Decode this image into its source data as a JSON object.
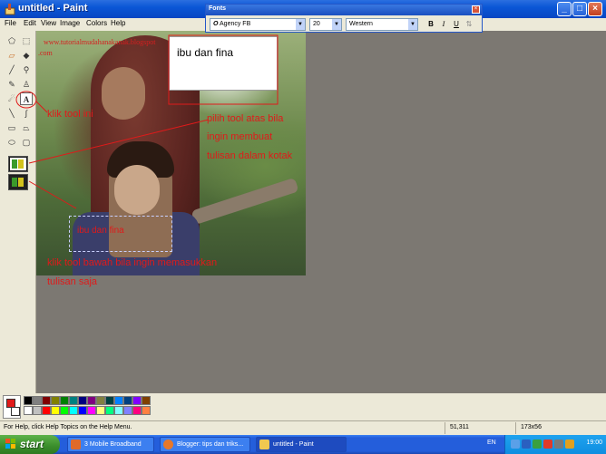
{
  "window": {
    "title": "untitled - Paint",
    "controls": {
      "minimize": "_",
      "maximize": "□",
      "close": "×"
    }
  },
  "menu": [
    "File",
    "Edit",
    "View",
    "Image",
    "Colors",
    "Help"
  ],
  "fonts_toolbar": {
    "title": "Fonts",
    "font_name": "Agency FB",
    "font_size": "20",
    "script": "Western",
    "buttons": [
      "B",
      "I",
      "U",
      "⇅"
    ]
  },
  "canvas": {
    "url_text_line1": "www.tutorialmudahanakanak.blogspot",
    "url_text_line2": ".com",
    "textbox_text": "ibu dan fina",
    "annotation_click": "klik tool ini",
    "annotation_box_1": "pilih tool atas bila",
    "annotation_box_2": "ingin membuat",
    "annotation_box_3": "tulisan dalam kotak",
    "dashed_text": "ibu dan fina",
    "annotation_bottom_1": "klik tool bawah bila ingin memasukkan",
    "annotation_bottom_2": "tulisan saja"
  },
  "palette": {
    "foreground": "#e01a1a",
    "background": "#ffffff",
    "colors_top": [
      "#000000",
      "#808080",
      "#800000",
      "#808000",
      "#008000",
      "#008080",
      "#000080",
      "#800080",
      "#808040",
      "#004040",
      "#0080ff",
      "#004080",
      "#8000ff",
      "#804000"
    ],
    "colors_bottom": [
      "#ffffff",
      "#c0c0c0",
      "#ff0000",
      "#ffff00",
      "#00ff00",
      "#00ffff",
      "#0000ff",
      "#ff00ff",
      "#ffff80",
      "#00ff80",
      "#80ffff",
      "#8080ff",
      "#ff0080",
      "#ff8040"
    ]
  },
  "statusbar": {
    "help_text": "For Help, click Help Topics on the Help Menu.",
    "coords": "51,311",
    "size": "173x56"
  },
  "taskbar": {
    "start_label": "start",
    "tasks": [
      {
        "label": "3 Mobile Broadband",
        "active": false
      },
      {
        "label": "Blogger: tips dan triks...",
        "active": false
      },
      {
        "label": "untitled - Paint",
        "active": true
      }
    ],
    "language": "EN",
    "clock": "19:00"
  },
  "tools": [
    "free-select",
    "select",
    "eraser",
    "fill",
    "picker",
    "magnifier",
    "pencil",
    "brush",
    "airbrush",
    "text",
    "line",
    "curve",
    "rectangle",
    "polygon",
    "ellipse",
    "rounded-rect"
  ]
}
